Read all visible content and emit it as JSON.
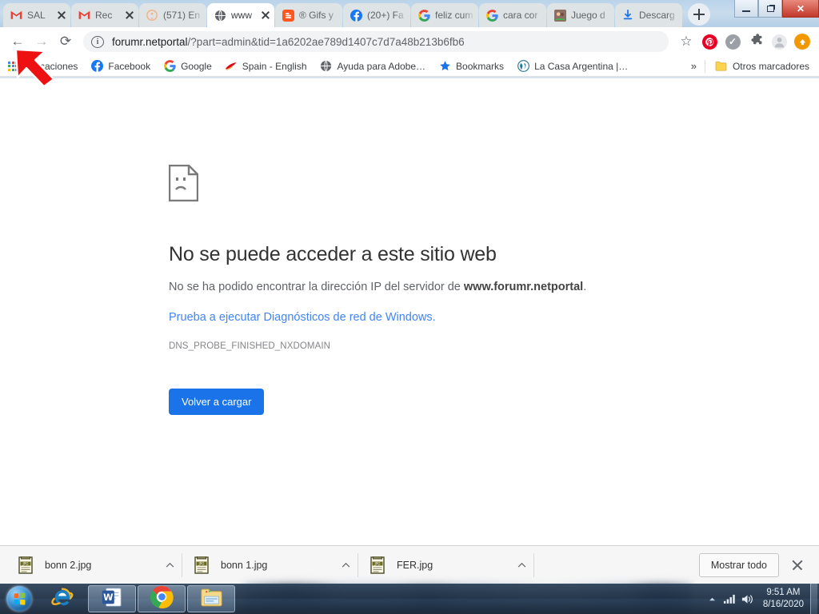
{
  "window": {
    "controls": {
      "minimize": "minimize",
      "restore": "restore",
      "close": "✕"
    }
  },
  "tabs": [
    {
      "label": "SAL",
      "favicon": "gmail-m",
      "active": false
    },
    {
      "label": "Rec",
      "favicon": "gmail-m",
      "active": false
    },
    {
      "label": "(571) En",
      "favicon": "orange-circle",
      "active": false
    },
    {
      "label": "www",
      "favicon": "globe",
      "active": true
    },
    {
      "label": "® Gifs y",
      "favicon": "blogger-b",
      "active": false
    },
    {
      "label": "(20+) Fa",
      "favicon": "facebook-f",
      "active": false
    },
    {
      "label": "feliz cum",
      "favicon": "google-g",
      "active": false
    },
    {
      "label": "cara cor",
      "favicon": "google-g",
      "active": false
    },
    {
      "label": "Juego d",
      "favicon": "photo",
      "active": false
    },
    {
      "label": "Descarg",
      "favicon": "download",
      "active": false
    }
  ],
  "newtab_label": "+",
  "toolbar": {
    "back_glyph": "←",
    "forward_glyph": "→",
    "reload_glyph": "⟳",
    "info_glyph": "i",
    "url_prefix": "forumr.netportal",
    "url_query": "/?part=admin&tid=1a6202ae789d1407c7d7a48b213b6fb6",
    "url_full": "forumr.netportal/?part=admin&tid=1a6202ae789d1407c7d7a48b213b6fb6",
    "star_glyph": "☆",
    "icons": [
      {
        "name": "pinterest-icon",
        "glyph": "P",
        "color": "#e60023"
      },
      {
        "name": "check-circle-icon",
        "glyph": "✓",
        "color": "#9aa0a6"
      },
      {
        "name": "extensions-puzzle-icon",
        "glyph": "🧩",
        "color": "#5f6368"
      },
      {
        "name": "profile-avatar-icon",
        "glyph": "",
        "color": "#dadce0"
      },
      {
        "name": "update-chrome-icon",
        "glyph": "↑",
        "color": "#f29900"
      }
    ]
  },
  "bookmarks": {
    "items": [
      {
        "label": "Aplicaciones",
        "icon": "apps-grid"
      },
      {
        "label": "Facebook",
        "icon": "facebook-f"
      },
      {
        "label": "Google",
        "icon": "google-g"
      },
      {
        "label": "Spain - English",
        "icon": "iberia-red"
      },
      {
        "label": "Ayuda para Adobe…",
        "icon": "globe"
      },
      {
        "label": "Bookmarks",
        "icon": "star-blue"
      },
      {
        "label": "La Casa Argentina |…",
        "icon": "wordpress-w"
      }
    ],
    "overflow_glyph": "»",
    "other": {
      "label": "Otros marcadores",
      "icon": "folder-yellow"
    }
  },
  "page": {
    "icon_name": "sad-page-icon",
    "title": "No se puede acceder a este sitio web",
    "subtitle_prefix": "No se ha podido encontrar la dirección IP del servidor de ",
    "subtitle_host": "www.forumr.netportal",
    "subtitle_suffix": ".",
    "link": "Prueba a ejecutar Diagnósticos de red de Windows.",
    "error_code": "DNS_PROBE_FINISHED_NXDOMAIN",
    "reload_button": "Volver a cargar"
  },
  "downloads": {
    "items": [
      {
        "name": "bonn 2.jpg",
        "type": "JPG"
      },
      {
        "name": "bonn 1.jpg",
        "type": "JPG"
      },
      {
        "name": "FER.jpg",
        "type": "JPG"
      }
    ],
    "chevron_glyph": "︿",
    "show_all": "Mostrar todo",
    "close_glyph": "✕"
  },
  "taskbar": {
    "start_name": "windows-start-orb",
    "apps": [
      {
        "name": "internet-explorer",
        "glyph": "e",
        "running": false
      },
      {
        "name": "microsoft-word",
        "glyph": "W",
        "running": true
      },
      {
        "name": "google-chrome",
        "glyph": "",
        "running": true
      },
      {
        "name": "file-explorer",
        "glyph": "",
        "running": true
      }
    ],
    "tray": {
      "expand_glyph": "▲",
      "network_name": "network-signal-icon",
      "volume_name": "volume-icon"
    },
    "time": "9:51 AM",
    "date": "8/16/2020"
  },
  "annotation": {
    "name": "red-arrow-annotation",
    "color": "#ee1111"
  }
}
